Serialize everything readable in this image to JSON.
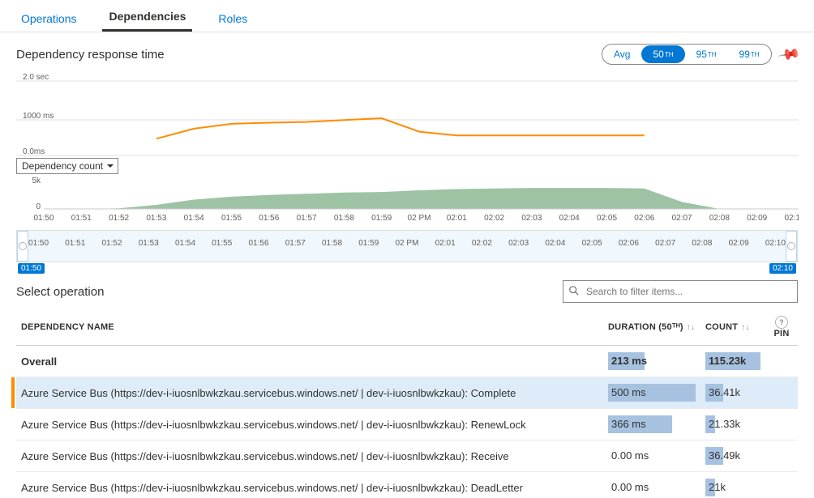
{
  "tabs": {
    "items": [
      "Operations",
      "Dependencies",
      "Roles"
    ],
    "active": 1
  },
  "header": {
    "title": "Dependency response time",
    "percentiles": {
      "items": [
        "Avg",
        "50",
        "95",
        "99"
      ],
      "active": 1
    }
  },
  "chart_data": [
    {
      "type": "line",
      "title": "Dependency response time",
      "ylabel": "ms",
      "y_ticks": [
        "2.0 sec",
        "1000 ms",
        "0.0ms"
      ],
      "ylim": [
        0,
        2000
      ],
      "categories": [
        "01:50",
        "01:51",
        "01:52",
        "01:53",
        "01:54",
        "01:55",
        "01:56",
        "01:57",
        "01:58",
        "01:59",
        "02 PM",
        "02:01",
        "02:02",
        "02:03",
        "02:04",
        "02:05",
        "02:06",
        "02:07",
        "02:08",
        "02:09",
        "02:10"
      ],
      "series": [
        {
          "name": "response-time-ms",
          "color": "#ff8c00",
          "values": [
            null,
            null,
            null,
            450,
            720,
            850,
            880,
            900,
            950,
            1000,
            640,
            540,
            540,
            540,
            540,
            540,
            540,
            null,
            null,
            null,
            null
          ]
        }
      ]
    },
    {
      "type": "area",
      "title": "Dependency count",
      "ylabel": "count",
      "y_ticks": [
        "5k",
        "0"
      ],
      "ylim": [
        0,
        5000
      ],
      "categories": [
        "01:50",
        "01:51",
        "01:52",
        "01:53",
        "01:54",
        "01:55",
        "01:56",
        "01:57",
        "01:58",
        "01:59",
        "02 PM",
        "02:01",
        "02:02",
        "02:03",
        "02:04",
        "02:05",
        "02:06",
        "02:07",
        "02:08",
        "02:09",
        "02:10"
      ],
      "series": [
        {
          "name": "dependency-count",
          "color": "#8db894",
          "values": [
            0,
            0,
            100,
            700,
            1600,
            2100,
            2400,
            2600,
            2800,
            2900,
            3200,
            3400,
            3500,
            3600,
            3600,
            3600,
            3500,
            1200,
            0,
            0,
            0
          ]
        }
      ]
    }
  ],
  "count_dropdown": "Dependency count",
  "time_slider": {
    "labels": [
      "01:50",
      "01:51",
      "01:52",
      "01:53",
      "01:54",
      "01:55",
      "01:56",
      "01:57",
      "01:58",
      "01:59",
      "02 PM",
      "02:01",
      "02:02",
      "02:03",
      "02:04",
      "02:05",
      "02:06",
      "02:07",
      "02:08",
      "02:09",
      "02:10"
    ],
    "start": "01:50",
    "end": "02:10"
  },
  "select_operation": {
    "title": "Select operation",
    "search_placeholder": "Search to filter items..."
  },
  "table": {
    "columns": {
      "name": "Dependency name",
      "duration": "Duration (50ᵀᴴ)",
      "count": "Count",
      "pin": "Pin"
    },
    "rows": [
      {
        "name": "Overall",
        "duration": "213 ms",
        "dur_pct": 42,
        "count": "115.23k",
        "cnt_pct": 100,
        "overall": true,
        "selected": false
      },
      {
        "name": "Azure Service Bus (https://dev-i-iuosnlbwkzkau.servicebus.windows.net/ | dev-i-iuosnlbwkzkau): Complete",
        "duration": "500 ms",
        "dur_pct": 100,
        "count": "36.41k",
        "cnt_pct": 32,
        "overall": false,
        "selected": true
      },
      {
        "name": "Azure Service Bus (https://dev-i-iuosnlbwkzkau.servicebus.windows.net/ | dev-i-iuosnlbwkzkau): RenewLock",
        "duration": "366 ms",
        "dur_pct": 73,
        "count": "21.33k",
        "cnt_pct": 18,
        "overall": false,
        "selected": false
      },
      {
        "name": "Azure Service Bus (https://dev-i-iuosnlbwkzkau.servicebus.windows.net/ | dev-i-iuosnlbwkzkau): Receive",
        "duration": "0.00 ms",
        "dur_pct": 0,
        "count": "36.49k",
        "cnt_pct": 32,
        "overall": false,
        "selected": false
      },
      {
        "name": "Azure Service Bus (https://dev-i-iuosnlbwkzkau.servicebus.windows.net/ | dev-i-iuosnlbwkzkau): DeadLetter",
        "duration": "0.00 ms",
        "dur_pct": 0,
        "count": "21k",
        "cnt_pct": 18,
        "overall": false,
        "selected": false
      }
    ]
  }
}
